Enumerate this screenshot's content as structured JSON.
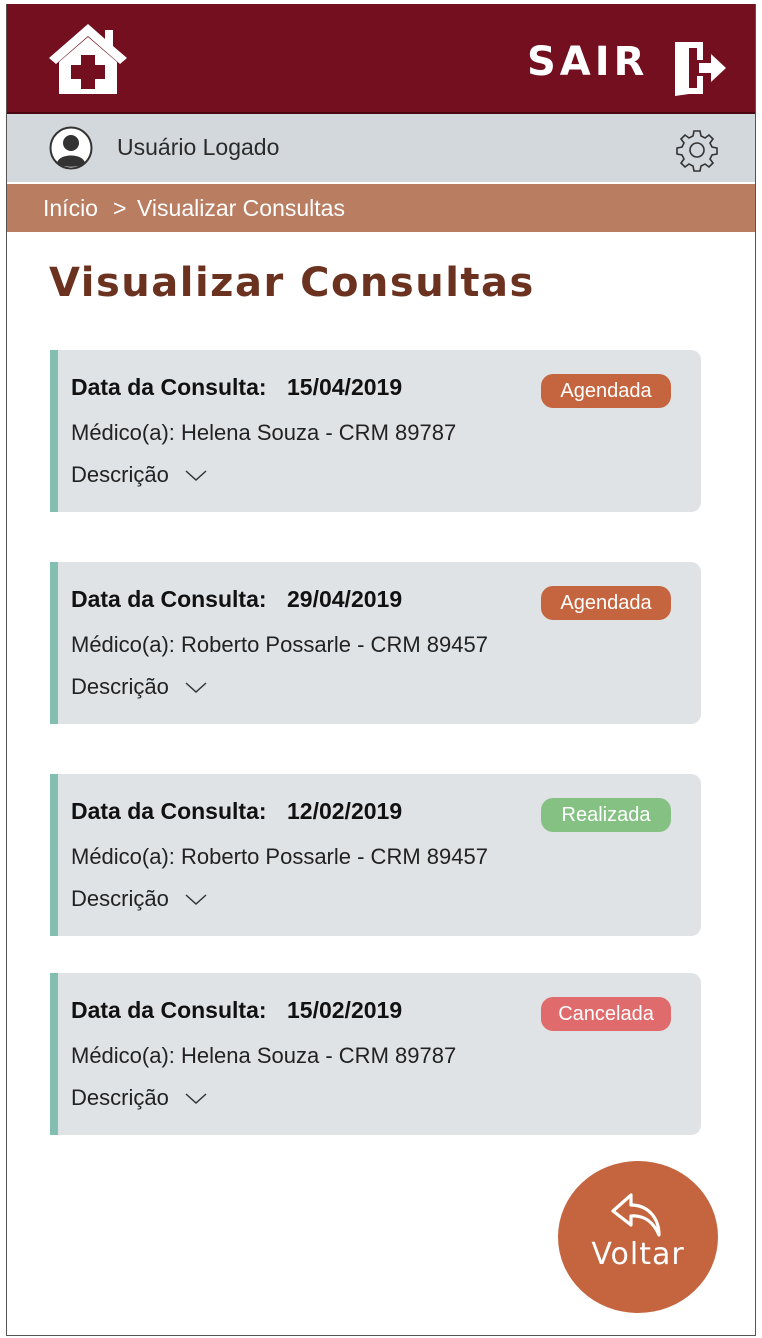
{
  "header": {
    "home_icon": "home-medical-icon",
    "logout_label": "SAIR",
    "logout_icon": "exit-door-icon",
    "background_color": "#730f1f"
  },
  "user_bar": {
    "avatar_icon": "user-avatar-icon",
    "user_name": "Usuário Logado",
    "settings_icon": "gear-icon"
  },
  "breadcrumb": {
    "home": "Início",
    "separator": ">",
    "current": "Visualizar Consultas",
    "background_color": "#b97d62"
  },
  "page": {
    "title": "Visualizar Consultas"
  },
  "appointments": [
    {
      "date_label": "Data da Consulta:",
      "date": "15/04/2019",
      "doctor": "Médico(a): Helena Souza - CRM 89787",
      "description_label": "Descrição",
      "status": "Agendada",
      "status_color": "#c4653f"
    },
    {
      "date_label": "Data da Consulta:",
      "date": "29/04/2019",
      "doctor": "Médico(a): Roberto Possarle - CRM 89457",
      "description_label": "Descrição",
      "status": "Agendada",
      "status_color": "#c4653f"
    },
    {
      "date_label": "Data da Consulta:",
      "date": "12/02/2019",
      "doctor": "Médico(a): Roberto Possarle - CRM 89457",
      "description_label": "Descrição",
      "status": "Realizada",
      "status_color": "#86c184"
    },
    {
      "date_label": "Data da Consulta:",
      "date": "15/02/2019",
      "doctor": "Médico(a): Helena Souza - CRM 89787",
      "description_label": "Descrição",
      "status": "Cancelada",
      "status_color": "#e06b6d"
    }
  ],
  "back_button": {
    "label": "Voltar",
    "icon": "reply-arrow-icon",
    "color": "#c4653f"
  }
}
